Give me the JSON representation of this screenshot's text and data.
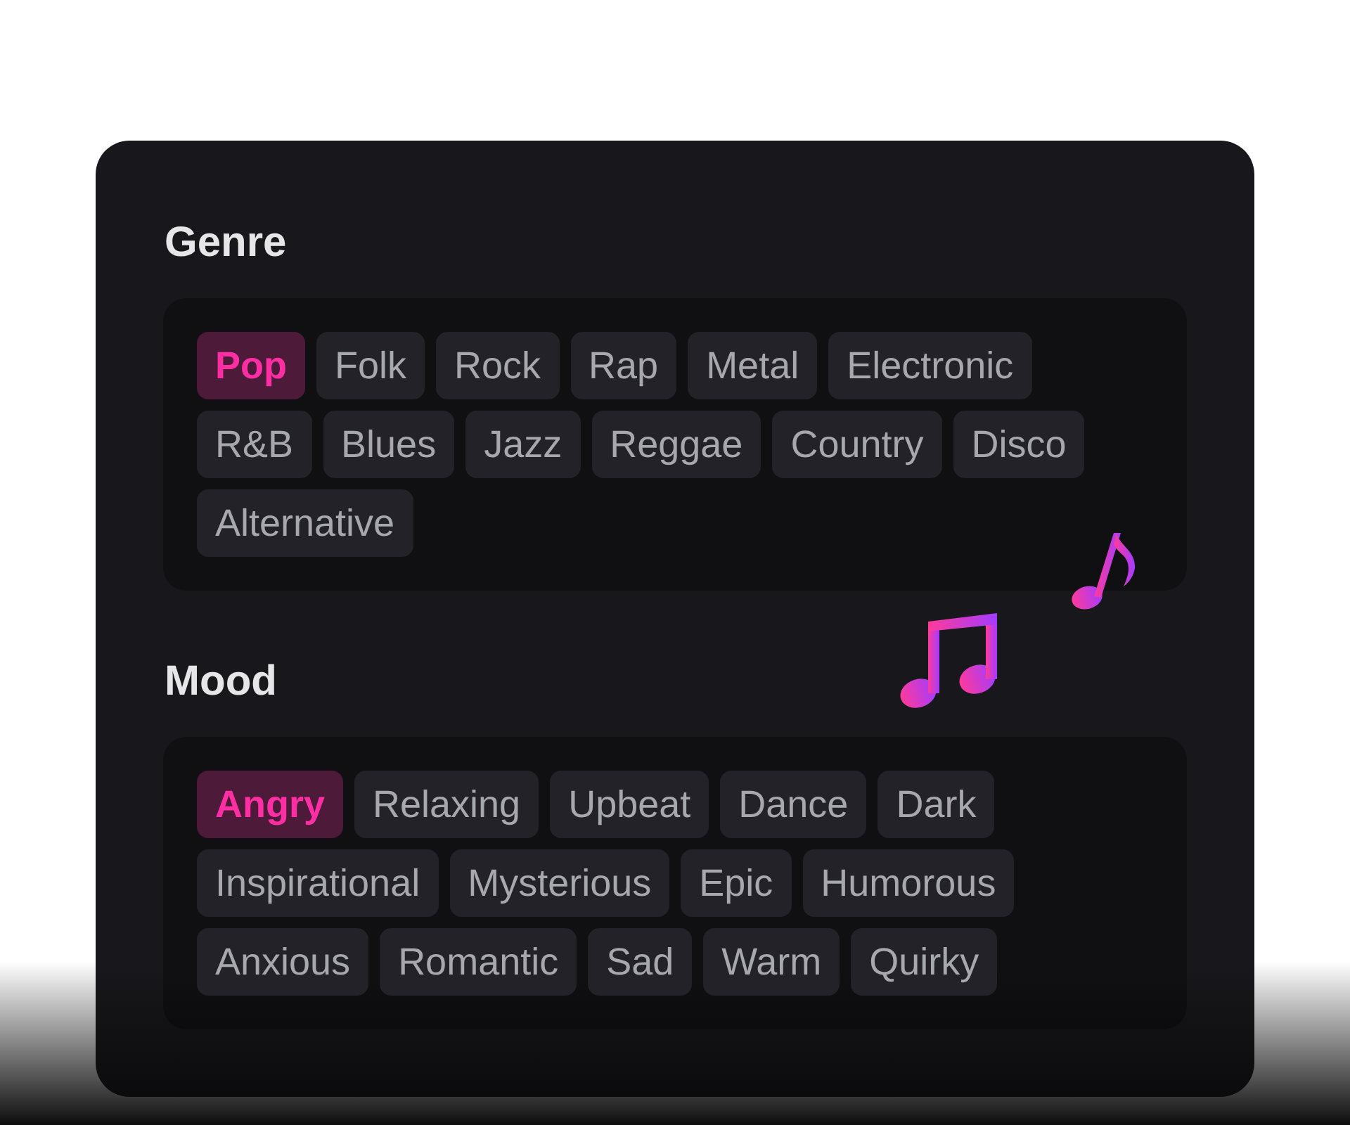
{
  "sections": [
    {
      "title": "Genre",
      "tags": [
        {
          "label": "Pop",
          "selected": true
        },
        {
          "label": "Folk",
          "selected": false
        },
        {
          "label": "Rock",
          "selected": false
        },
        {
          "label": "Rap",
          "selected": false
        },
        {
          "label": "Metal",
          "selected": false
        },
        {
          "label": "Electronic",
          "selected": false
        },
        {
          "label": "R&B",
          "selected": false
        },
        {
          "label": "Blues",
          "selected": false
        },
        {
          "label": "Jazz",
          "selected": false
        },
        {
          "label": "Reggae",
          "selected": false
        },
        {
          "label": "Country",
          "selected": false
        },
        {
          "label": "Disco",
          "selected": false
        },
        {
          "label": "Alternative",
          "selected": false
        }
      ]
    },
    {
      "title": "Mood",
      "tags": [
        {
          "label": "Angry",
          "selected": true
        },
        {
          "label": "Relaxing",
          "selected": false
        },
        {
          "label": "Upbeat",
          "selected": false
        },
        {
          "label": "Dance",
          "selected": false
        },
        {
          "label": "Dark",
          "selected": false
        },
        {
          "label": "Inspirational",
          "selected": false
        },
        {
          "label": "Mysterious",
          "selected": false
        },
        {
          "label": "Epic",
          "selected": false
        },
        {
          "label": "Humorous",
          "selected": false
        },
        {
          "label": "Anxious",
          "selected": false
        },
        {
          "label": "Romantic",
          "selected": false
        },
        {
          "label": "Sad",
          "selected": false
        },
        {
          "label": "Warm",
          "selected": false
        },
        {
          "label": "Quirky",
          "selected": false
        }
      ]
    }
  ]
}
